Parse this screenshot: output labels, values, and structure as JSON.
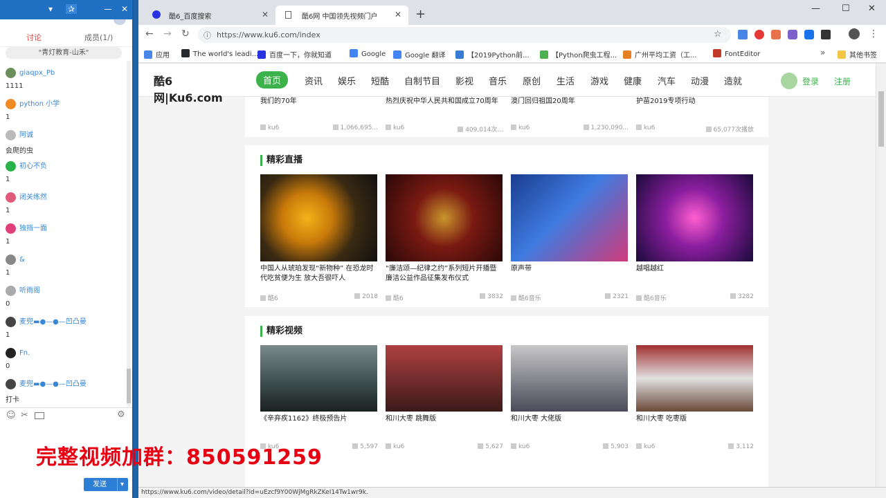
{
  "chat": {
    "tab_discuss": "讨论",
    "tab_members": "成员(1/)",
    "pinned": "\"青灯教育-山禾\"",
    "messages": [
      {
        "user": "giaqpx_Pb",
        "text": "1111",
        "color": "#6b8e5a"
      },
      {
        "user": "python 小学",
        "text": "1",
        "color": "#f08a24"
      },
      {
        "user": "阿诚",
        "text": "会爬的虫",
        "color": "#bbbbbb"
      },
      {
        "user": "初心不负",
        "text": "1",
        "color": "#2ab24a"
      },
      {
        "user": "闭关练然",
        "text": "1",
        "color": "#e05a7a"
      },
      {
        "user": "独挡一面",
        "text": "1",
        "color": "#e0407a"
      },
      {
        "user": "&",
        "text": "1",
        "color": "#888888"
      },
      {
        "user": "听雨阁",
        "text": "0",
        "color": "#aaaaaa"
      },
      {
        "user": "麦兜▬●—●—凹凸曼",
        "text": "1",
        "color": "#444444"
      },
      {
        "user": "Fn.",
        "text": "0",
        "color": "#222222"
      },
      {
        "user": "麦兜▬●—●—凹凸曼",
        "text": "打卡",
        "color": "#444444"
      }
    ],
    "send_label": "发送",
    "toolbar_icons": [
      "emoji-icon",
      "scissors-icon",
      "image-icon",
      "settings-icon"
    ]
  },
  "promo_text": "完整视频加群：850591259",
  "browser": {
    "tabs": [
      {
        "title": "酷6_百度搜索",
        "active": false
      },
      {
        "title": "酷6网 中国领先视频门户",
        "active": true
      }
    ],
    "url": "https://www.ku6.com/index",
    "bookmarks": [
      {
        "label": "应用",
        "color": "#4a86e8"
      },
      {
        "label": "The world's leadi...",
        "color": "#24292e"
      },
      {
        "label": "百度一下，你就知道",
        "color": "#2932e1"
      },
      {
        "label": "Google",
        "color": "#4285f4"
      },
      {
        "label": "Google 翻译",
        "color": "#4285f4"
      },
      {
        "label": "【2019Python前...",
        "color": "#3a7bd5"
      },
      {
        "label": "【Python爬虫工程...",
        "color": "#4caf50"
      },
      {
        "label": "广州平均工资（工...",
        "color": "#e67e22"
      },
      {
        "label": "FontEditor",
        "color": "#c0392b"
      }
    ],
    "other_bookmarks": "其他书签",
    "status_url": "https://www.ku6.com/video/detail?id=uEzcf9Y00WjMgRkZKeI14Tw1wr9k."
  },
  "site": {
    "logo_text": "酷6网|Ku6.com",
    "nav": [
      "首页",
      "资讯",
      "娱乐",
      "短酷",
      "自制节目",
      "影视",
      "音乐",
      "原创",
      "生活",
      "游戏",
      "健康",
      "汽车",
      "动漫",
      "造就"
    ],
    "login": "登录",
    "register": "注册",
    "top_row": [
      {
        "title": "我们的70年",
        "src": "ku6",
        "count": "1,066,695..."
      },
      {
        "title": "热烈庆祝中华人民共和国成立70周年",
        "src": "ku6",
        "count": "409,014次..."
      },
      {
        "title": "澳门回归祖国20周年",
        "src": "ku6",
        "count": "1,230,090..."
      },
      {
        "title": "护苗2019专项行动",
        "src": "ku6",
        "count": "65,077次播放"
      }
    ],
    "live_section": {
      "heading": "精彩直播",
      "cards": [
        {
          "title": "中国人从琥珀发现“新物种” 在恐龙时代吃贫便为生 放大吾很吓人",
          "src": "酷6",
          "count": "2018"
        },
        {
          "title": "“廉洁颂—纪律之约”系列短片开播暨廉洁公益作品征集发布仪式",
          "src": "酷6",
          "count": "3832"
        },
        {
          "title": "原声带",
          "src": "酷6音乐",
          "count": "2321"
        },
        {
          "title": "越唱越红",
          "src": "酷6音乐",
          "count": "3282"
        }
      ]
    },
    "video_section": {
      "heading": "精彩视频",
      "cards": [
        {
          "title": "《辛弃疾1162》终极预告片",
          "src": "ku6",
          "count": "5,597"
        },
        {
          "title": "和川大枣 跳舞版",
          "src": "ku6",
          "count": "5,627"
        },
        {
          "title": "和川大枣 大佬版",
          "src": "ku6",
          "count": "5,903"
        },
        {
          "title": "和川大枣 吃枣版",
          "src": "ku6",
          "count": "3,112"
        }
      ]
    }
  }
}
